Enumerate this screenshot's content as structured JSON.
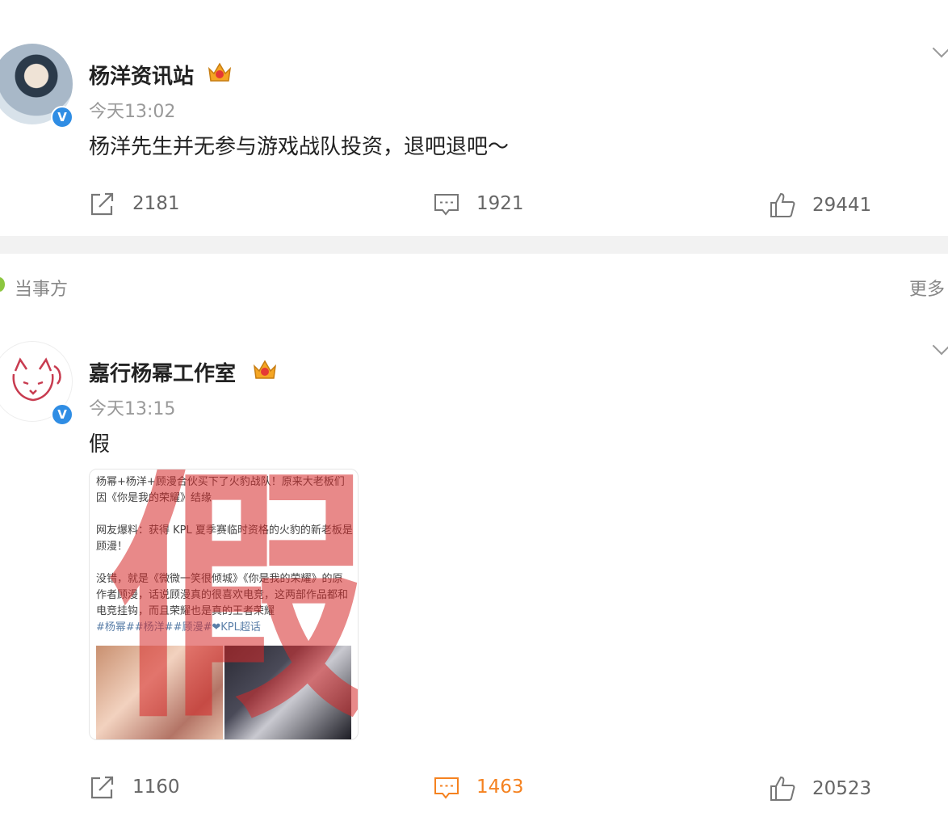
{
  "post1": {
    "author": "杨洋资讯站",
    "time": "今天13:02",
    "text": "杨洋先生并无参与游戏战队投资，退吧退吧～",
    "verified_badge": "V",
    "repost_count": "2181",
    "comment_count": "1921",
    "like_count": "29441"
  },
  "section": {
    "label": "当事方",
    "more": "更多"
  },
  "post2": {
    "author": "嘉行杨幂工作室",
    "time": "今天13:15",
    "text": "假",
    "verified_badge": "V",
    "image": {
      "line1": "杨幂+杨洋+顾漫合伙买下了火豹战队！原来大老板们因《你是我的荣耀》结缘",
      "line2": "网友爆料：获得 KPL 夏季赛临时资格的火豹的新老板是顾漫！",
      "line3": "没错，就是《微微一笑很倾城》《你是我的荣耀》的原作者顾漫，话说顾漫真的很喜欢电竞，这两部作品都和电竞挂钩，而且荣耀也是真的王者荣耀",
      "tags": "#杨幂##杨洋##顾漫#❤KPL超话",
      "stamp": "假"
    },
    "repost_count": "1160",
    "comment_count": "1463",
    "like_count": "20523"
  },
  "colors": {
    "accent_orange": "#f58220",
    "verified_blue": "#2f8de4",
    "stamp_red": "#d62828"
  }
}
